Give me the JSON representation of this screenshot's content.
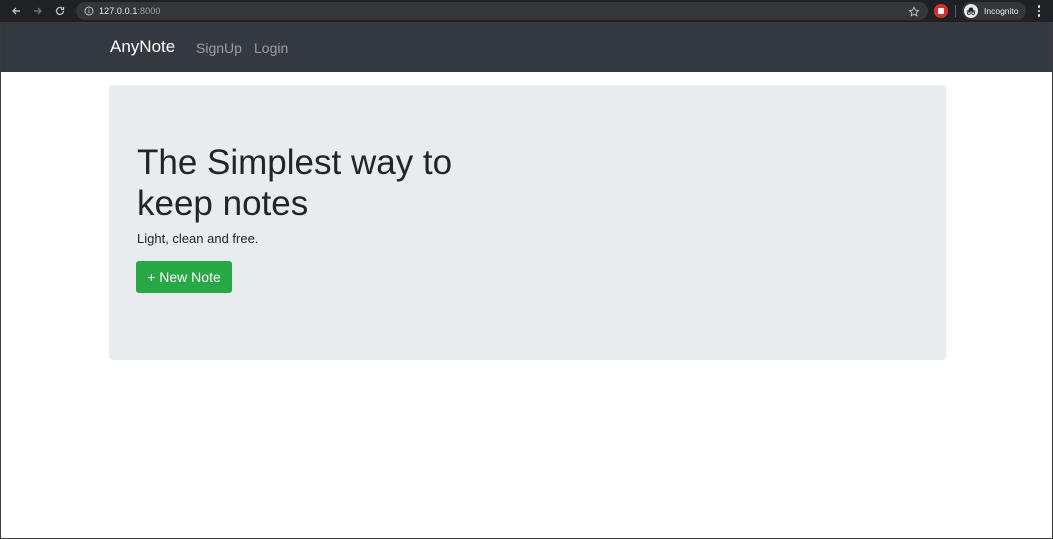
{
  "browser": {
    "url_host": "127.0.0.1",
    "url_port": ":8000",
    "profile_label": "Incognito"
  },
  "navbar": {
    "brand": "AnyNote",
    "links": [
      "SignUp",
      "Login"
    ]
  },
  "hero": {
    "title": "The Simplest way to keep notes",
    "lead": "Light, clean and free.",
    "button_label": "+ New Note",
    "button_color": "#28a745",
    "background_color": "#e9ecef"
  },
  "colors": {
    "navbar": "#343a40",
    "chrome": "#202124"
  }
}
